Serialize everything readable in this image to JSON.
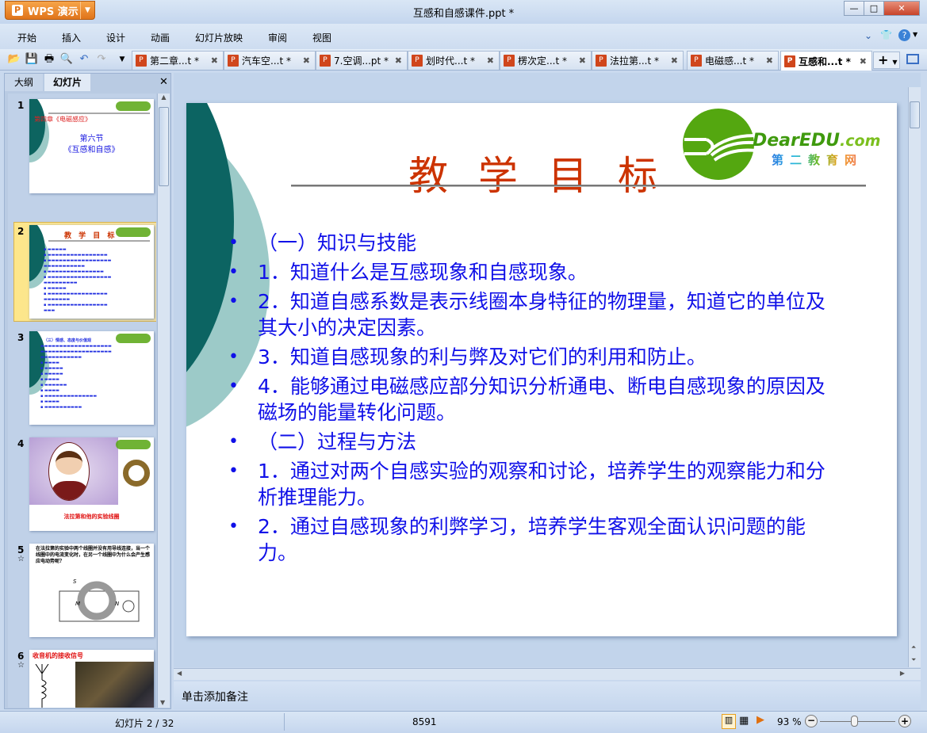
{
  "app": {
    "name": "WPS 演示",
    "document_title": "互感和自感课件.ppt *"
  },
  "menu": [
    "开始",
    "插入",
    "设计",
    "动画",
    "幻灯片放映",
    "审阅",
    "视图"
  ],
  "doc_tabs": [
    {
      "label": "第二章...t *",
      "active": false
    },
    {
      "label": "汽车空...t *",
      "active": false
    },
    {
      "label": "7.空调...pt *",
      "active": false
    },
    {
      "label": "划时代...t *",
      "active": false
    },
    {
      "label": "楞次定...t *",
      "active": false
    },
    {
      "label": "法拉第...t *",
      "active": false
    },
    {
      "label": "电磁感...t *",
      "active": false
    },
    {
      "label": "互感和...t *",
      "active": true
    }
  ],
  "left_panel": {
    "tabs": [
      "大纲",
      "幻灯片"
    ],
    "active_tab": "幻灯片",
    "selected_slide": 2,
    "thumbnails": [
      {
        "num": "1",
        "lines": [
          "第四章《电磁感应》",
          "第六节",
          "《互感和自感》"
        ]
      },
      {
        "num": "2",
        "lines": [
          "教 学 目 标"
        ]
      },
      {
        "num": "3",
        "lines": [
          "（三）情感、态度与价值观"
        ]
      },
      {
        "num": "4",
        "lines": [
          "法拉第和他的实验线圈"
        ]
      },
      {
        "num": "5",
        "lines": [
          "在法拉第的实验中两个线圈并没有用导线连接，当一个线圈中的电流变化时，在另一个线圈中为什么会产生感应电动势呢？"
        ]
      },
      {
        "num": "6",
        "lines": [
          "收音机的接收信号"
        ]
      }
    ]
  },
  "slide": {
    "title": "教学目标",
    "logo_text": "DearEDU.com",
    "logo_subtext": "第二教育网",
    "bullets": [
      "（一）知识与技能",
      "1．知道什么是互感现象和自感现象。",
      "2．知道自感系数是表示线圈本身特征的物理量，知道它的单位及其大小的决定因素。",
      "3．知道自感现象的利与弊及对它们的利用和防止。",
      "4．能够通过电磁感应部分知识分析通电、断电自感现象的原因及磁场的能量转化问题。",
      "（二）过程与方法",
      "1．通过对两个自感实验的观察和讨论，培养学生的观察能力和分析推理能力。",
      "2．通过自感现象的利弊学习，培养学生客观全面认识问题的能力。"
    ],
    "title_color": "#cc3300",
    "body_color": "#1010e8"
  },
  "notes_placeholder": "单击添加备注",
  "status": {
    "slide_indicator": "幻灯片 2 / 32",
    "center": "8591",
    "zoom": "93 %",
    "zoom_level_percent": 93
  }
}
